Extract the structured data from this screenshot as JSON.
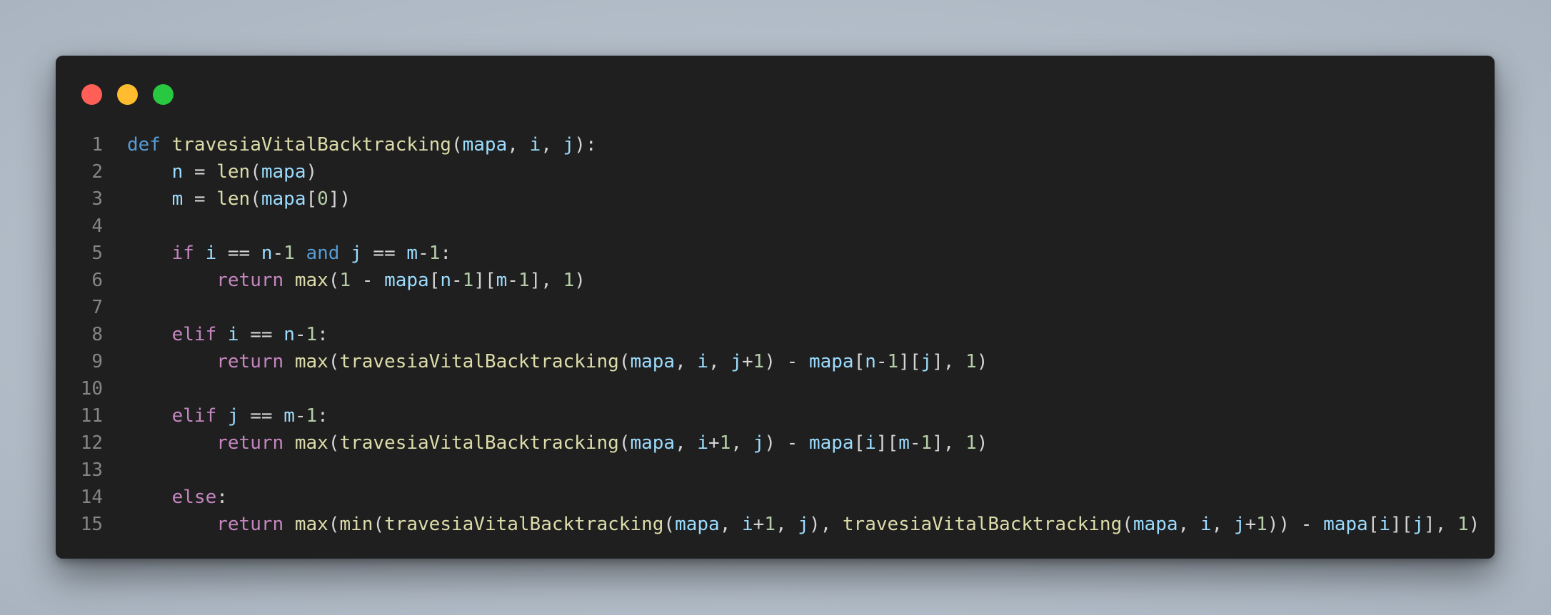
{
  "window": {
    "controls": [
      {
        "name": "close",
        "color": "#ff5f57"
      },
      {
        "name": "minimize",
        "color": "#febc2e"
      },
      {
        "name": "maximize",
        "color": "#28c840"
      }
    ]
  },
  "theme": {
    "keyword_control": "#c586c0",
    "keyword": "#569cd6",
    "function": "#dcdcaa",
    "variable": "#9cdcfe",
    "number": "#b5cea8",
    "punctuation": "#d4d4d4",
    "line_number": "#858585",
    "background": "#1f1f1f"
  },
  "code": {
    "lines": [
      {
        "n": "1",
        "tokens": [
          [
            "kw",
            "def"
          ],
          [
            "p",
            " "
          ],
          [
            "f",
            "travesiaVitalBacktracking"
          ],
          [
            "p",
            "("
          ],
          [
            "v",
            "mapa"
          ],
          [
            "p",
            ", "
          ],
          [
            "v",
            "i"
          ],
          [
            "p",
            ", "
          ],
          [
            "v",
            "j"
          ],
          [
            "p",
            "):"
          ]
        ]
      },
      {
        "n": "2",
        "tokens": [
          [
            "p",
            "    "
          ],
          [
            "v",
            "n"
          ],
          [
            "p",
            " = "
          ],
          [
            "f",
            "len"
          ],
          [
            "p",
            "("
          ],
          [
            "v",
            "mapa"
          ],
          [
            "p",
            ")"
          ]
        ]
      },
      {
        "n": "3",
        "tokens": [
          [
            "p",
            "    "
          ],
          [
            "v",
            "m"
          ],
          [
            "p",
            " = "
          ],
          [
            "f",
            "len"
          ],
          [
            "p",
            "("
          ],
          [
            "v",
            "mapa"
          ],
          [
            "p",
            "["
          ],
          [
            "nm",
            "0"
          ],
          [
            "p",
            "])"
          ]
        ]
      },
      {
        "n": "4",
        "tokens": []
      },
      {
        "n": "5",
        "tokens": [
          [
            "p",
            "    "
          ],
          [
            "k",
            "if"
          ],
          [
            "p",
            " "
          ],
          [
            "v",
            "i"
          ],
          [
            "p",
            " == "
          ],
          [
            "v",
            "n"
          ],
          [
            "p",
            "-"
          ],
          [
            "nm",
            "1"
          ],
          [
            "p",
            " "
          ],
          [
            "kw",
            "and"
          ],
          [
            "p",
            " "
          ],
          [
            "v",
            "j"
          ],
          [
            "p",
            " == "
          ],
          [
            "v",
            "m"
          ],
          [
            "p",
            "-"
          ],
          [
            "nm",
            "1"
          ],
          [
            "p",
            ":"
          ]
        ]
      },
      {
        "n": "6",
        "tokens": [
          [
            "p",
            "        "
          ],
          [
            "k",
            "return"
          ],
          [
            "p",
            " "
          ],
          [
            "f",
            "max"
          ],
          [
            "p",
            "("
          ],
          [
            "nm",
            "1"
          ],
          [
            "p",
            " - "
          ],
          [
            "v",
            "mapa"
          ],
          [
            "p",
            "["
          ],
          [
            "v",
            "n"
          ],
          [
            "p",
            "-"
          ],
          [
            "nm",
            "1"
          ],
          [
            "p",
            "]["
          ],
          [
            "v",
            "m"
          ],
          [
            "p",
            "-"
          ],
          [
            "nm",
            "1"
          ],
          [
            "p",
            "], "
          ],
          [
            "nm",
            "1"
          ],
          [
            "p",
            ")"
          ]
        ]
      },
      {
        "n": "7",
        "tokens": []
      },
      {
        "n": "8",
        "tokens": [
          [
            "p",
            "    "
          ],
          [
            "k",
            "elif"
          ],
          [
            "p",
            " "
          ],
          [
            "v",
            "i"
          ],
          [
            "p",
            " == "
          ],
          [
            "v",
            "n"
          ],
          [
            "p",
            "-"
          ],
          [
            "nm",
            "1"
          ],
          [
            "p",
            ":"
          ]
        ]
      },
      {
        "n": "9",
        "tokens": [
          [
            "p",
            "        "
          ],
          [
            "k",
            "return"
          ],
          [
            "p",
            " "
          ],
          [
            "f",
            "max"
          ],
          [
            "p",
            "("
          ],
          [
            "f",
            "travesiaVitalBacktracking"
          ],
          [
            "p",
            "("
          ],
          [
            "v",
            "mapa"
          ],
          [
            "p",
            ", "
          ],
          [
            "v",
            "i"
          ],
          [
            "p",
            ", "
          ],
          [
            "v",
            "j"
          ],
          [
            "p",
            "+"
          ],
          [
            "nm",
            "1"
          ],
          [
            "p",
            ") - "
          ],
          [
            "v",
            "mapa"
          ],
          [
            "p",
            "["
          ],
          [
            "v",
            "n"
          ],
          [
            "p",
            "-"
          ],
          [
            "nm",
            "1"
          ],
          [
            "p",
            "]["
          ],
          [
            "v",
            "j"
          ],
          [
            "p",
            "], "
          ],
          [
            "nm",
            "1"
          ],
          [
            "p",
            ")"
          ]
        ]
      },
      {
        "n": "10",
        "tokens": []
      },
      {
        "n": "11",
        "tokens": [
          [
            "p",
            "    "
          ],
          [
            "k",
            "elif"
          ],
          [
            "p",
            " "
          ],
          [
            "v",
            "j"
          ],
          [
            "p",
            " == "
          ],
          [
            "v",
            "m"
          ],
          [
            "p",
            "-"
          ],
          [
            "nm",
            "1"
          ],
          [
            "p",
            ":"
          ]
        ]
      },
      {
        "n": "12",
        "tokens": [
          [
            "p",
            "        "
          ],
          [
            "k",
            "return"
          ],
          [
            "p",
            " "
          ],
          [
            "f",
            "max"
          ],
          [
            "p",
            "("
          ],
          [
            "f",
            "travesiaVitalBacktracking"
          ],
          [
            "p",
            "("
          ],
          [
            "v",
            "mapa"
          ],
          [
            "p",
            ", "
          ],
          [
            "v",
            "i"
          ],
          [
            "p",
            "+"
          ],
          [
            "nm",
            "1"
          ],
          [
            "p",
            ", "
          ],
          [
            "v",
            "j"
          ],
          [
            "p",
            ") - "
          ],
          [
            "v",
            "mapa"
          ],
          [
            "p",
            "["
          ],
          [
            "v",
            "i"
          ],
          [
            "p",
            "]["
          ],
          [
            "v",
            "m"
          ],
          [
            "p",
            "-"
          ],
          [
            "nm",
            "1"
          ],
          [
            "p",
            "], "
          ],
          [
            "nm",
            "1"
          ],
          [
            "p",
            ")"
          ]
        ]
      },
      {
        "n": "13",
        "tokens": []
      },
      {
        "n": "14",
        "tokens": [
          [
            "p",
            "    "
          ],
          [
            "k",
            "else"
          ],
          [
            "p",
            ":"
          ]
        ]
      },
      {
        "n": "15",
        "tokens": [
          [
            "p",
            "        "
          ],
          [
            "k",
            "return"
          ],
          [
            "p",
            " "
          ],
          [
            "f",
            "max"
          ],
          [
            "p",
            "("
          ],
          [
            "f",
            "min"
          ],
          [
            "p",
            "("
          ],
          [
            "f",
            "travesiaVitalBacktracking"
          ],
          [
            "p",
            "("
          ],
          [
            "v",
            "mapa"
          ],
          [
            "p",
            ", "
          ],
          [
            "v",
            "i"
          ],
          [
            "p",
            "+"
          ],
          [
            "nm",
            "1"
          ],
          [
            "p",
            ", "
          ],
          [
            "v",
            "j"
          ],
          [
            "p",
            "), "
          ],
          [
            "f",
            "travesiaVitalBacktracking"
          ],
          [
            "p",
            "("
          ],
          [
            "v",
            "mapa"
          ],
          [
            "p",
            ", "
          ],
          [
            "v",
            "i"
          ],
          [
            "p",
            ", "
          ],
          [
            "v",
            "j"
          ],
          [
            "p",
            "+"
          ],
          [
            "nm",
            "1"
          ],
          [
            "p",
            ")) - "
          ],
          [
            "v",
            "mapa"
          ],
          [
            "p",
            "["
          ],
          [
            "v",
            "i"
          ],
          [
            "p",
            "]["
          ],
          [
            "v",
            "j"
          ],
          [
            "p",
            "], "
          ],
          [
            "nm",
            "1"
          ],
          [
            "p",
            ")"
          ]
        ]
      }
    ]
  }
}
